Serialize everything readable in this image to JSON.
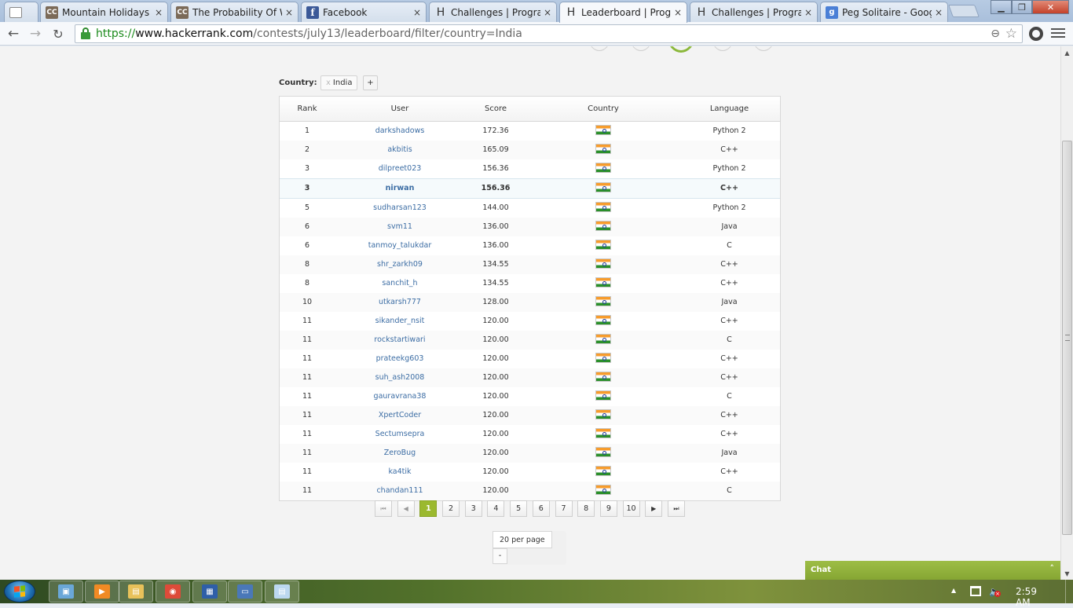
{
  "browser": {
    "tabs": [
      {
        "title": "",
        "favicon": "blank-page-icon",
        "active": false
      },
      {
        "title": "Mountain Holidays |",
        "favicon": "cc-icon",
        "active": false
      },
      {
        "title": "The Probability Of W",
        "favicon": "cc-icon",
        "active": false
      },
      {
        "title": "Facebook",
        "favicon": "facebook-icon",
        "active": false
      },
      {
        "title": "Challenges | Program",
        "favicon": "hackerrank-icon",
        "active": false
      },
      {
        "title": "Leaderboard | Progra",
        "favicon": "hackerrank-icon",
        "active": true
      },
      {
        "title": "Challenges | Program",
        "favicon": "hackerrank-icon",
        "active": false
      },
      {
        "title": "Peg Solitaire - Googl",
        "favicon": "google-icon",
        "active": false
      }
    ],
    "tab_close_glyph": "×",
    "favicon_letters": {
      "cc": "CC",
      "facebook": "f",
      "hackerrank": "H",
      "google": "g"
    },
    "window_controls": {
      "minimize": "▁",
      "maximize": "❐",
      "close": "✕"
    },
    "toolbar": {
      "back": "←",
      "forward": "→",
      "reload": "↻"
    },
    "url": {
      "scheme": "https://",
      "host": "www.hackerrank.com",
      "path": "/contests/july13/leaderboard/filter/country=India"
    },
    "omnibox_icons": {
      "zoom": "⊖",
      "star": "☆"
    }
  },
  "page": {
    "filter": {
      "label": "Country:",
      "chip_remove": "x",
      "chip_value": "India",
      "add_button": "+"
    },
    "table": {
      "headers": {
        "rank": "Rank",
        "user": "User",
        "score": "Score",
        "country": "Country",
        "language": "Language"
      },
      "country_flag": "india-flag-icon",
      "highlighted_user": "nirwan",
      "rows": [
        {
          "rank": "1",
          "user": "darkshadows",
          "score": "172.36",
          "language": "Python 2"
        },
        {
          "rank": "2",
          "user": "akbitis",
          "score": "165.09",
          "language": "C++"
        },
        {
          "rank": "3",
          "user": "dilpreet023",
          "score": "156.36",
          "language": "Python 2"
        },
        {
          "rank": "3",
          "user": "nirwan",
          "score": "156.36",
          "language": "C++"
        },
        {
          "rank": "5",
          "user": "sudharsan123",
          "score": "144.00",
          "language": "Python 2"
        },
        {
          "rank": "6",
          "user": "svm11",
          "score": "136.00",
          "language": "Java"
        },
        {
          "rank": "6",
          "user": "tanmoy_talukdar",
          "score": "136.00",
          "language": "C"
        },
        {
          "rank": "8",
          "user": "shr_zarkh09",
          "score": "134.55",
          "language": "C++"
        },
        {
          "rank": "8",
          "user": "sanchit_h",
          "score": "134.55",
          "language": "C++"
        },
        {
          "rank": "10",
          "user": "utkarsh777",
          "score": "128.00",
          "language": "Java"
        },
        {
          "rank": "11",
          "user": "sikander_nsit",
          "score": "120.00",
          "language": "C++"
        },
        {
          "rank": "11",
          "user": "rockstartiwari",
          "score": "120.00",
          "language": "C"
        },
        {
          "rank": "11",
          "user": "prateekg603",
          "score": "120.00",
          "language": "C++"
        },
        {
          "rank": "11",
          "user": "suh_ash2008",
          "score": "120.00",
          "language": "C++"
        },
        {
          "rank": "11",
          "user": "gauravrana38",
          "score": "120.00",
          "language": "C"
        },
        {
          "rank": "11",
          "user": "XpertCoder",
          "score": "120.00",
          "language": "C++"
        },
        {
          "rank": "11",
          "user": "Sectumsepra",
          "score": "120.00",
          "language": "C++"
        },
        {
          "rank": "11",
          "user": "ZeroBug",
          "score": "120.00",
          "language": "Java"
        },
        {
          "rank": "11",
          "user": "ka4tik",
          "score": "120.00",
          "language": "C++"
        },
        {
          "rank": "11",
          "user": "chandan111",
          "score": "120.00",
          "language": "C"
        }
      ]
    },
    "pagination": {
      "first": "⏮",
      "prev": "◀",
      "pages": [
        "1",
        "2",
        "3",
        "4",
        "5",
        "6",
        "7",
        "8",
        "9",
        "10"
      ],
      "current_page": "1",
      "next": "▶",
      "last": "⏭"
    },
    "per_page": {
      "label": "20 per page",
      "toggle": "-"
    },
    "chat": {
      "label": "Chat",
      "toggle": "˄"
    }
  },
  "taskbar": {
    "pinned": [
      "computer-icon",
      "media-player-icon",
      "explorer-folder-icon",
      "chrome-icon",
      "network-app-icon",
      "remote-desktop-icon",
      "notepad-icon"
    ],
    "tray_arrow": "▲",
    "clock": "2:59 AM"
  },
  "colors": {
    "accent_green": "#9bb92f",
    "link_blue": "#3c6da4",
    "url_green": "#1a8a1a"
  }
}
